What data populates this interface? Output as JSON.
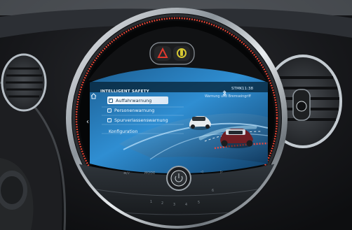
{
  "screen": {
    "header_title": "INTELLIGENT SAFETY",
    "status_label": "STMK",
    "clock": "11:38",
    "notice": "Warnung und Bremseingriff",
    "menu": [
      {
        "label": "Auffahrwarnung",
        "checked": true,
        "selected": true
      },
      {
        "label": "Personenwarnung",
        "checked": true,
        "selected": false
      },
      {
        "label": "Spurverlassenswarnung",
        "checked": true,
        "selected": false
      }
    ],
    "config_label": "Konfiguration"
  },
  "controls": {
    "mode_label": "MODE",
    "left_label": "⊕/♪",
    "presets": [
      "1",
      "2",
      "3",
      "4",
      "5",
      "6"
    ]
  },
  "colors": {
    "screen_blue": "#2f8ed2",
    "ring_chrome": "#d8dde3",
    "ring_ambient": "#ff4b39",
    "hazard_red": "#e0392e",
    "hazard_yellow": "#d7c832"
  }
}
